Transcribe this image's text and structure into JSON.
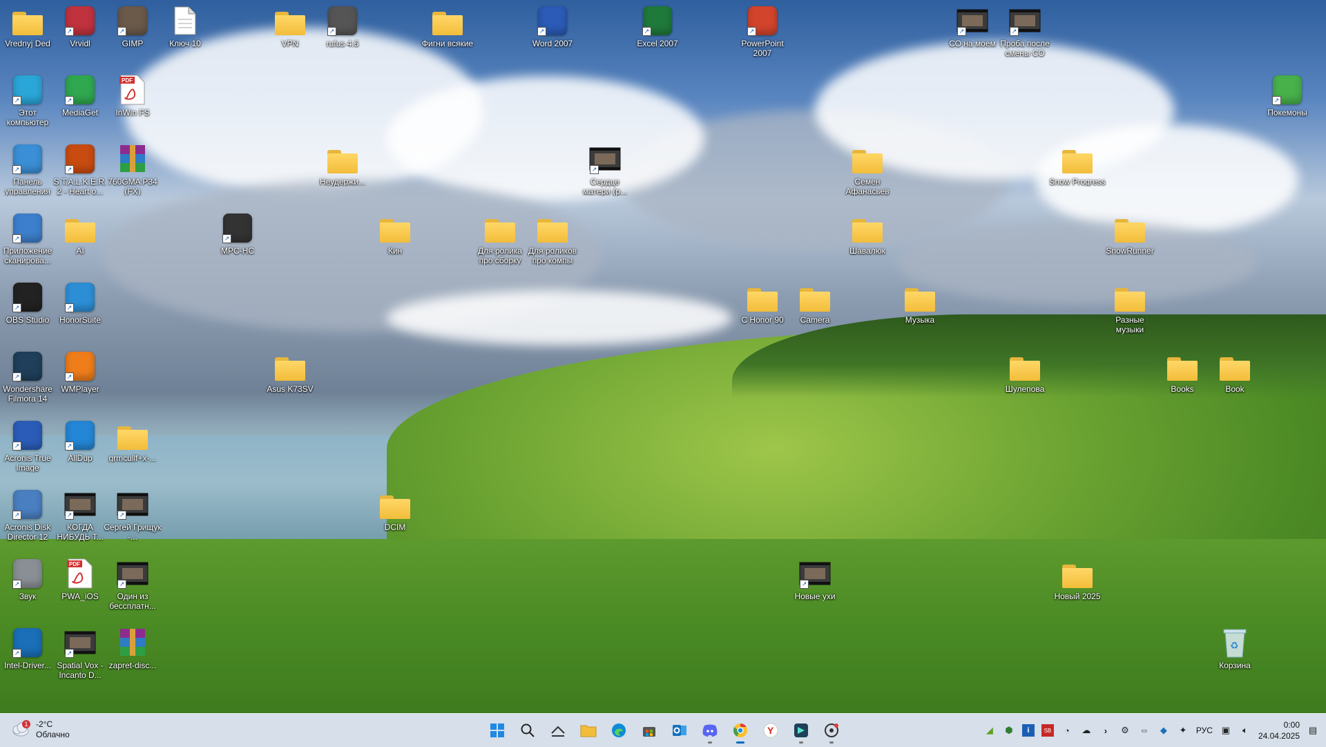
{
  "desktop": {
    "icons": [
      {
        "label": "Vrednyj Ded",
        "type": "folder"
      },
      {
        "label": "Vrvidl",
        "type": "app",
        "color": "#c0323d"
      },
      {
        "label": "GIMP",
        "type": "app",
        "color": "#6b5a4a"
      },
      {
        "label": "Ключ 10",
        "type": "file"
      },
      {
        "label": "VPN",
        "type": "folder"
      },
      {
        "label": "rufus 4.6",
        "type": "app",
        "color": "#555"
      },
      {
        "label": "Фигни всякие",
        "type": "folder"
      },
      {
        "label": "Word 2007",
        "type": "app",
        "color": "#2b5bb6"
      },
      {
        "label": "Excel 2007",
        "type": "app",
        "color": "#1f7a3a"
      },
      {
        "label": "PowerPoint 2007",
        "type": "app",
        "color": "#d3442c"
      },
      {
        "label": "СО на моем",
        "type": "video"
      },
      {
        "label": "Проба после смены СО",
        "type": "video"
      },
      {
        "label": "Этот компьютер",
        "type": "app",
        "color": "#2aa6d8"
      },
      {
        "label": "MediaGet",
        "type": "app",
        "color": "#2fa84f"
      },
      {
        "label": "InWin FS",
        "type": "pdf"
      },
      {
        "label": "Покемоны",
        "type": "app",
        "color": "#48b14a"
      },
      {
        "label": "Панель управления",
        "type": "app",
        "color": "#3b8fd6"
      },
      {
        "label": "S.T.A.L.K.E.R. 2 - Heart o...",
        "type": "app",
        "color": "#c84b10"
      },
      {
        "label": "760GMA P34 (FX)",
        "type": "archive"
      },
      {
        "label": "Неудержи...",
        "type": "folder"
      },
      {
        "label": "Сердце матери (р...",
        "type": "video"
      },
      {
        "label": "Семен Афанасьев",
        "type": "folder"
      },
      {
        "label": "Snow Progress",
        "type": "folder"
      },
      {
        "label": "Приложение сканирова...",
        "type": "app",
        "color": "#3d7fcc"
      },
      {
        "label": "AI",
        "type": "folder"
      },
      {
        "label": "MPC-HC",
        "type": "app",
        "color": "#333"
      },
      {
        "label": "Кин",
        "type": "folder"
      },
      {
        "label": "Для ролика про сборку",
        "type": "folder"
      },
      {
        "label": "Для роликов про компы",
        "type": "folder"
      },
      {
        "label": "Шавалюк",
        "type": "folder"
      },
      {
        "label": "SnowRunner",
        "type": "folder"
      },
      {
        "label": "OBS Studio",
        "type": "app",
        "color": "#222"
      },
      {
        "label": "HonorSuite",
        "type": "app",
        "color": "#2c8fd6"
      },
      {
        "label": "С Honor 90",
        "type": "folder"
      },
      {
        "label": "Camera",
        "type": "folder"
      },
      {
        "label": "Музыка",
        "type": "folder"
      },
      {
        "label": "Разные музыки",
        "type": "folder"
      },
      {
        "label": "Wondershare Filmora 14",
        "type": "app",
        "color": "#1f3f5a"
      },
      {
        "label": "WMPlayer",
        "type": "app",
        "color": "#ef7d1a"
      },
      {
        "label": "Asus K73SV",
        "type": "folder"
      },
      {
        "label": "Шулепова",
        "type": "folder"
      },
      {
        "label": "Books",
        "type": "folder"
      },
      {
        "label": "Book",
        "type": "folder"
      },
      {
        "label": "Acronis True Image",
        "type": "app",
        "color": "#2b5db8"
      },
      {
        "label": "AllDup",
        "type": "app",
        "color": "#2486d6"
      },
      {
        "label": "grmcullf+x-...",
        "type": "folder"
      },
      {
        "label": "Acronis Disk Director 12",
        "type": "app",
        "color": "#4a7fc1"
      },
      {
        "label": "КОГДА НИБУДЬ Т...",
        "type": "video"
      },
      {
        "label": "Сергей Грищук -...",
        "type": "video"
      },
      {
        "label": "DCIM",
        "type": "folder"
      },
      {
        "label": "Звук",
        "type": "app",
        "color": "#8a8f96"
      },
      {
        "label": "PWA_iOS",
        "type": "pdf"
      },
      {
        "label": "Один из бессплатн...",
        "type": "video"
      },
      {
        "label": "Новые ухи",
        "type": "video"
      },
      {
        "label": "Новый 2025",
        "type": "folder"
      },
      {
        "label": "Intel-Driver...",
        "type": "app",
        "color": "#1a6fb8"
      },
      {
        "label": "Spatial Vox - Incanto D...",
        "type": "video"
      },
      {
        "label": "zapret-disc...",
        "type": "archive"
      },
      {
        "label": "Корзина",
        "type": "recycle"
      }
    ]
  },
  "taskbar": {
    "weather": {
      "temp": "-2°C",
      "condition": "Облачно",
      "badge": "1"
    },
    "apps": [
      {
        "name": "start",
        "icon": "windows-icon",
        "color": "#1e88e5"
      },
      {
        "name": "search",
        "icon": "search-icon",
        "color": "#222"
      },
      {
        "name": "widgets",
        "icon": "widgets-icon",
        "color": "#333"
      },
      {
        "name": "explorer",
        "icon": "folder-icon",
        "color": "#f2bd3a"
      },
      {
        "name": "edge",
        "icon": "edge-icon",
        "color": "#0f8ad8"
      },
      {
        "name": "store",
        "icon": "store-icon",
        "color": "#555"
      },
      {
        "name": "outlook",
        "icon": "outlook-icon",
        "color": "#1570c0"
      },
      {
        "name": "discord",
        "icon": "discord-icon",
        "color": "#5865f2"
      },
      {
        "name": "chrome",
        "icon": "chrome-icon",
        "color": "#e53935"
      },
      {
        "name": "yandex",
        "icon": "yandex-browser-icon",
        "color": "#d6271d"
      },
      {
        "name": "filmora",
        "icon": "filmora-icon",
        "color": "#1f3f5a"
      },
      {
        "name": "obs",
        "icon": "record-icon",
        "color": "#333"
      }
    ],
    "tray": {
      "language": "РУС",
      "time": "0:00",
      "date": "24.04.2025"
    }
  }
}
